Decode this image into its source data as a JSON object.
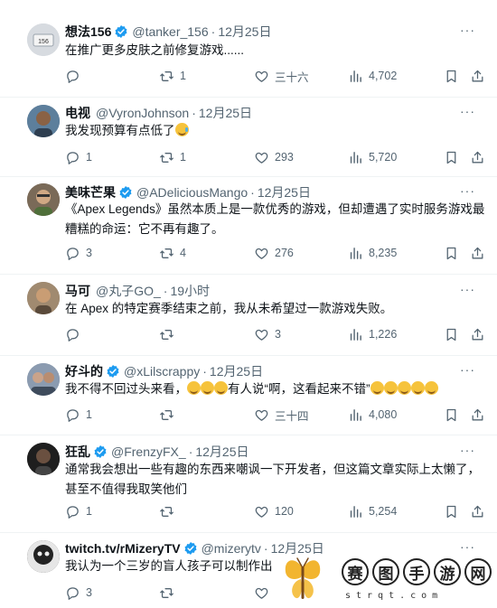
{
  "tweets": [
    {
      "name": "想法156",
      "handle": "@tanker_156",
      "time": "12月25日",
      "text": "在推广更多皮肤之前修复游戏......",
      "replies": "",
      "retweets": "1",
      "likes": "三十六",
      "views": "4,702",
      "verified": true,
      "avatar_color": "#c9ced6"
    },
    {
      "name": "电视",
      "handle": "@VyronJohnson",
      "time": "12月25日",
      "text": "我发现预算有点低了",
      "replies": "1",
      "retweets": "1",
      "likes": "293",
      "views": "5,720",
      "verified": false,
      "avatar_color": "#4a6b8a"
    },
    {
      "name": "美味芒果",
      "handle": "@ADeliciousMango",
      "time": "12月25日",
      "text": "《Apex Legends》虽然本质上是一款优秀的游戏，但却遭遇了实时服务游戏最糟糕的命运：它不再有趣了。",
      "replies": "3",
      "retweets": "4",
      "likes": "276",
      "views": "8,235",
      "verified": true,
      "avatar_color": "#6a5a4a"
    },
    {
      "name": "马可",
      "handle": "@丸子GO_",
      "time": "19小时",
      "text": "在 Apex 的特定赛季结束之前，我从未希望过一款游戏失败。",
      "replies": "",
      "retweets": "",
      "likes": "3",
      "views": "1,226",
      "verified": false,
      "avatar_color": "#8a7560"
    },
    {
      "name": "好斗的",
      "handle": "@xLilscrappy",
      "time": "12月25日",
      "text_a": "我不得不回过头来看，",
      "text_b": "有人说“啊，这看起来不错”",
      "replies": "1",
      "retweets": "",
      "likes": "三十四",
      "views": "4,080",
      "verified": true,
      "avatar_color": "#7a8aa0"
    },
    {
      "name": "狂乱",
      "handle": "@FrenzyFX_",
      "time": "12月25日",
      "text": "通常我会想出一些有趣的东西来嘲讽一下开发者，但这篇文章实际上太懒了，甚至不值得我取笑他们",
      "replies": "1",
      "retweets": "",
      "likes": "120",
      "views": "5,254",
      "verified": true,
      "avatar_color": "#2a2a2a"
    },
    {
      "name": "twitch.tv/rMizeryTV",
      "handle": "@mizerytv",
      "time": "12月25日",
      "text": "我认为一个三岁的盲人孩子可以制作出",
      "replies": "3",
      "retweets": "",
      "likes": "",
      "views": "",
      "verified": true,
      "avatar_color": "#3a3a3a"
    }
  ],
  "colors": {
    "verified": "#1d9bf0",
    "muted": "#536471",
    "text": "#0f1419",
    "divider": "#eff3f4"
  },
  "icons": [
    "reply-icon",
    "retweet-icon",
    "like-icon",
    "views-icon",
    "bookmark-icon",
    "share-icon",
    "verified-icon",
    "more-icon"
  ],
  "watermark": {
    "chars": [
      "赛",
      "图",
      "手",
      "游",
      "网"
    ],
    "domain": "strqt.com"
  }
}
